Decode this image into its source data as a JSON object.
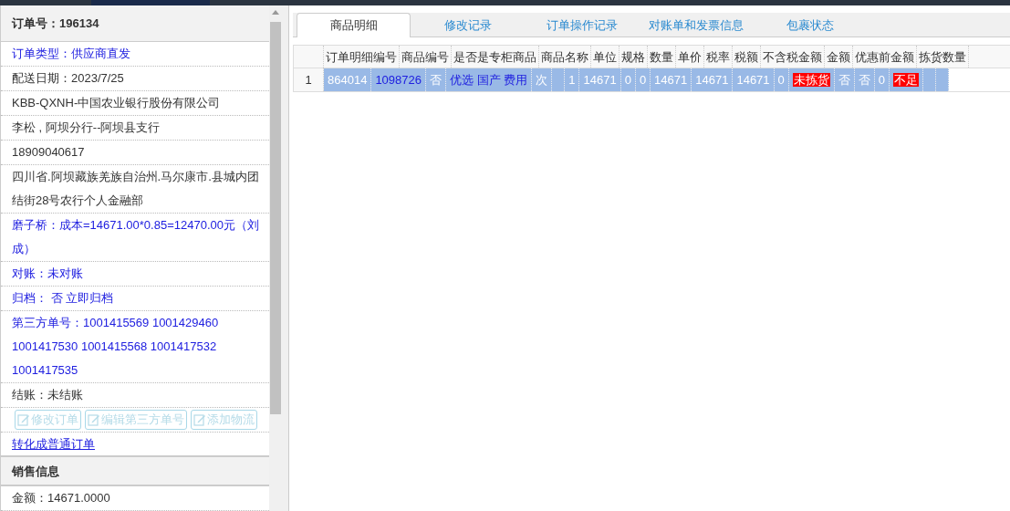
{
  "order_panel": {
    "title": "订单号：196134",
    "lines": [
      {
        "text": "订单类型：供应商直发",
        "link": true
      },
      {
        "text": "配送日期：2023/7/25",
        "link": false
      },
      {
        "text": "KBB-QXNH-中国农业银行股份有限公司",
        "link": false
      },
      {
        "text": "李松 , 阿坝分行--阿坝县支行",
        "link": false
      },
      {
        "text": "18909040617",
        "link": false
      },
      {
        "text": "四川省.阿坝藏族羌族自治州.马尔康市.县城内团结街28号农行个人金融部",
        "link": false
      },
      {
        "text": "磨子桥：成本=14671.00*0.85=12470.00元（刘成）",
        "link": true
      },
      {
        "text": "对账：未对账",
        "link": true
      },
      {
        "text": "归档： 否 立即归档",
        "link": true
      },
      {
        "text": "第三方单号：1001415569 1001429460 1001417530 1001415568 1001417532 1001417535",
        "link": true
      },
      {
        "text": "结账：未结账",
        "link": false
      }
    ],
    "buttons": [
      {
        "label": "修改订单",
        "disabled": true
      },
      {
        "label": "编辑第三方单号",
        "disabled": true
      },
      {
        "label": "添加物流",
        "disabled": true
      }
    ],
    "convert_link": "转化成普通订单",
    "sales_section": {
      "title": "销售信息",
      "amount": "金额：14671.0000"
    }
  },
  "tabs": [
    {
      "label": "商品明细",
      "selected": true
    },
    {
      "label": "修改记录",
      "selected": false
    },
    {
      "label": "订单操作记录",
      "selected": false
    },
    {
      "label": "对账单和发票信息",
      "selected": false
    },
    {
      "label": "包裹状态",
      "selected": false
    }
  ],
  "grid": {
    "headers": [
      "订单明细编号",
      "商品编号",
      "是否是专柜商品",
      "商品名称",
      "单位",
      "规格",
      "数量",
      "单价",
      "税率",
      "税额",
      "不含税金额",
      "金额",
      "优惠前金额",
      "拣货数量"
    ],
    "records": [
      {
        "number": "1",
        "selected": true,
        "cells": [
          {
            "kind": "text",
            "text": "864014"
          },
          {
            "kind": "link",
            "text": "1098726"
          },
          {
            "kind": "text",
            "text": "否"
          },
          {
            "kind": "link",
            "text": "优选 国产 费用"
          },
          {
            "kind": "text",
            "text": "次"
          },
          {
            "kind": "blank"
          },
          {
            "kind": "text",
            "text": "1"
          },
          {
            "kind": "text",
            "text": "14671"
          },
          {
            "kind": "text",
            "text": "0"
          },
          {
            "kind": "text",
            "text": "0"
          },
          {
            "kind": "text",
            "text": "14671"
          },
          {
            "kind": "text",
            "text": "14671"
          },
          {
            "kind": "text",
            "text": "14671"
          },
          {
            "kind": "text",
            "text": "0"
          },
          {
            "kind": "alert",
            "text": "未拣货"
          },
          {
            "kind": "text",
            "text": "否"
          },
          {
            "kind": "text",
            "text": "否"
          },
          {
            "kind": "text",
            "text": "0"
          },
          {
            "kind": "alert",
            "text": "不足"
          },
          {
            "kind": "blank"
          },
          {
            "kind": "blank"
          }
        ]
      }
    ]
  }
}
